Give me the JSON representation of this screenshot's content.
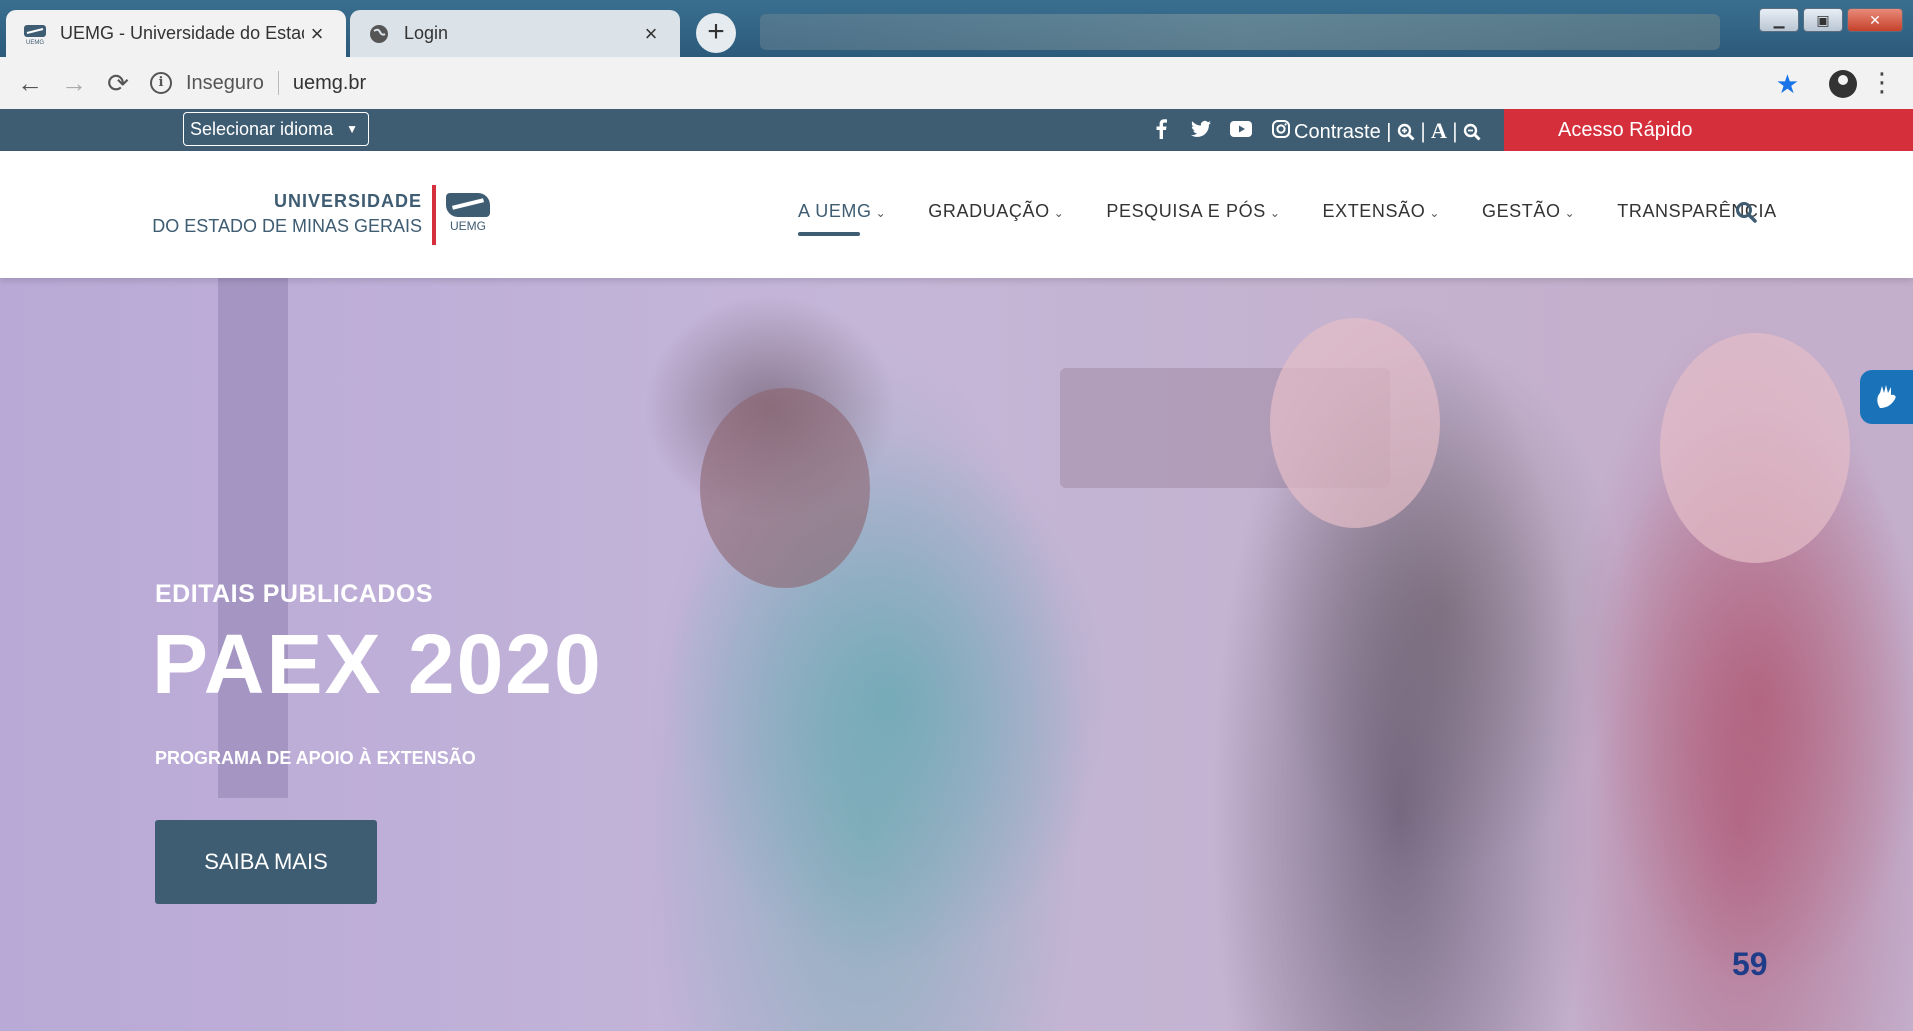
{
  "browser": {
    "tabs": [
      {
        "title": "UEMG - Universidade do Estado",
        "close": "×",
        "active": true
      },
      {
        "title": "Login",
        "close": "×",
        "active": false
      }
    ],
    "new_tab": "+",
    "address": {
      "security_label": "Inseguro",
      "url": "uemg.br"
    }
  },
  "topbar": {
    "language_select": "Selecionar idioma",
    "contrast_label": "Contraste |",
    "font_controls": [
      "|",
      "A",
      "|"
    ],
    "quick_access": "Acesso Rápido",
    "social_icons": [
      "facebook-icon",
      "twitter-icon",
      "youtube-icon",
      "instagram-icon"
    ]
  },
  "header": {
    "logo_line1": "UNIVERSIDADE",
    "logo_line2": "DO ESTADO DE MINAS GERAIS",
    "logo_mark": "UEMG",
    "nav": [
      "A UEMG",
      "GRADUAÇÃO",
      "PESQUISA E PÓS",
      "EXTENSÃO",
      "GESTÃO",
      "TRANSPARÊNCIA"
    ]
  },
  "hero": {
    "kicker": "EDITAIS PUBLICADOS",
    "title": "PAEX 2020",
    "subtitle": "PROGRAMA DE APOIO À EXTENSÃO",
    "button": "SAIBA MAIS"
  },
  "slide_number": "59",
  "colors": {
    "brand": "#3e5c72",
    "accent": "#d62f3c",
    "star": "#1a73e8"
  }
}
